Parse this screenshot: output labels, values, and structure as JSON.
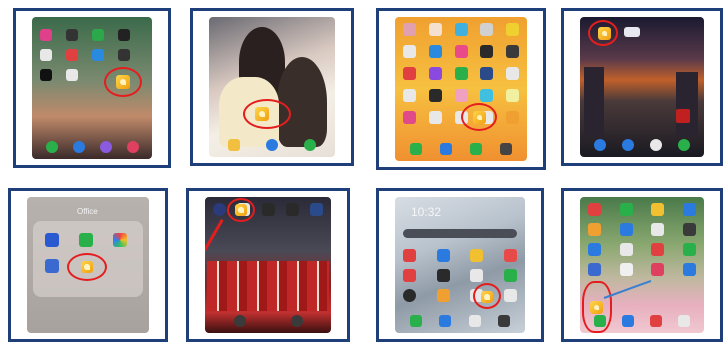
{
  "colors": {
    "frame": "#1f3f7a",
    "highlight": "#e41e1e",
    "app_icon": "#f0b020"
  },
  "panels": [
    {
      "id": "1",
      "app_icon": "app-icon",
      "highlighted": true
    },
    {
      "id": "2",
      "app_icon": "app-icon",
      "highlighted": true
    },
    {
      "id": "3",
      "app_icon": "app-icon",
      "highlighted": true
    },
    {
      "id": "4",
      "app_icon": "app-icon",
      "highlighted": true
    },
    {
      "id": "5",
      "folder_label": "Office",
      "app_icon": "app-icon",
      "highlighted": true
    },
    {
      "id": "6",
      "app_icon": "app-icon",
      "highlighted": true
    },
    {
      "id": "7",
      "clock_text": "10:32",
      "app_icon": "app-icon",
      "highlighted": true
    },
    {
      "id": "8",
      "app_icon": "app-icon",
      "highlighted": true
    }
  ]
}
